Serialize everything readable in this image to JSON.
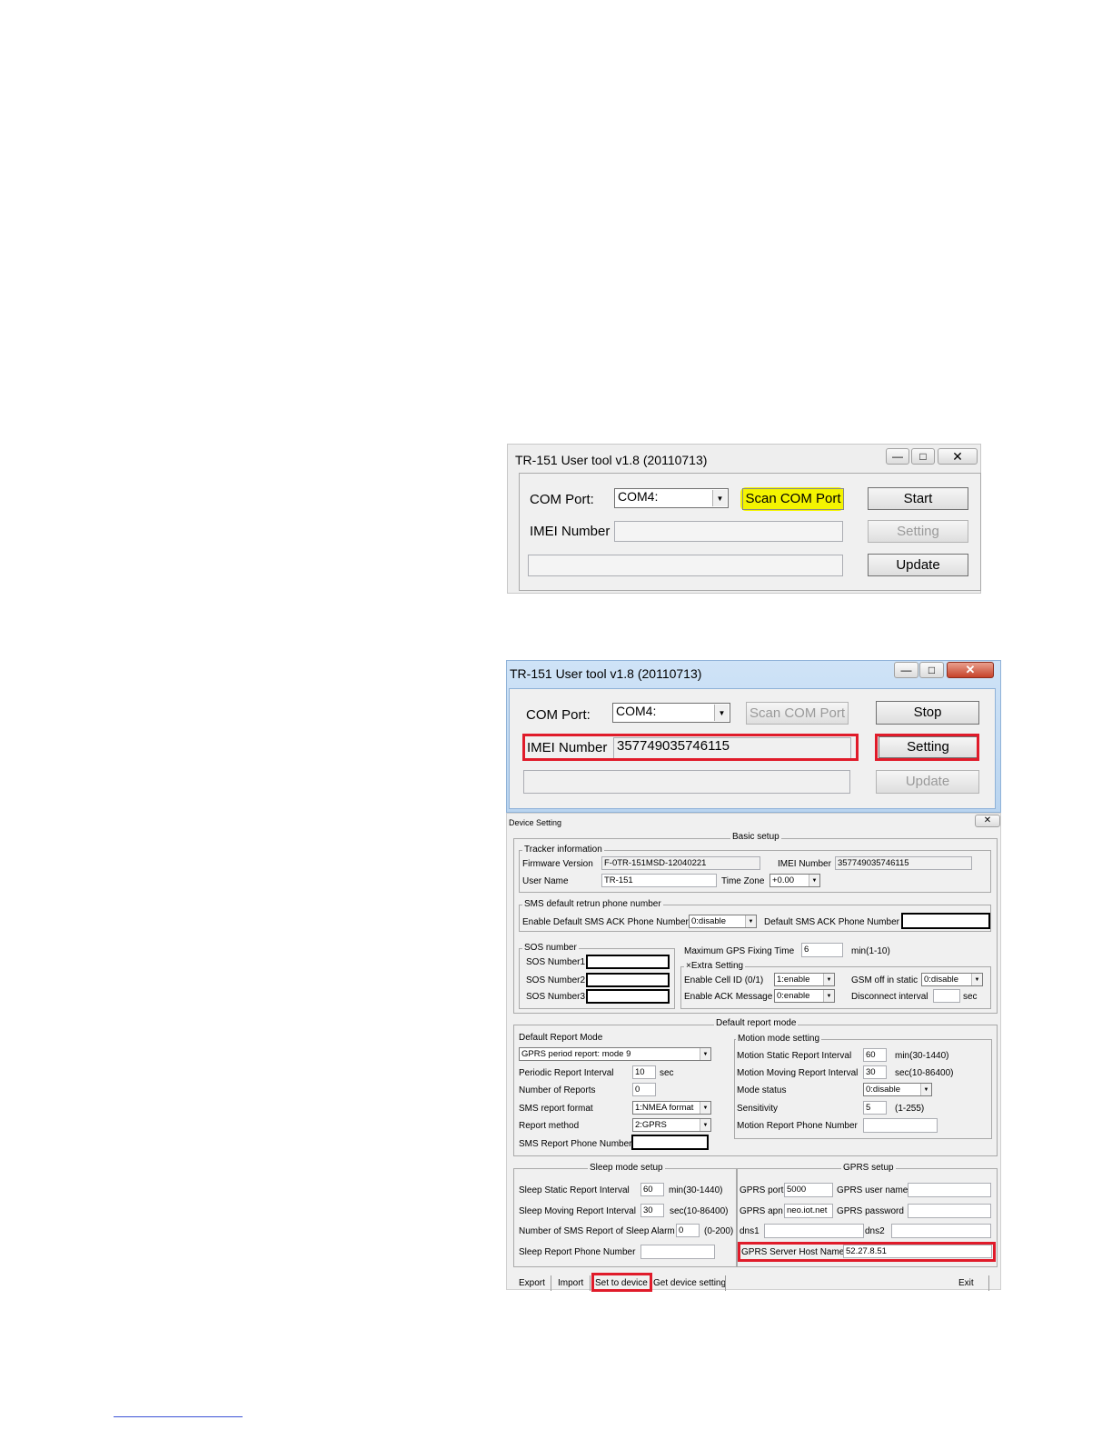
{
  "window1": {
    "title": "TR-151 User tool v1.8 (20110713)",
    "com_port_label": "COM Port:",
    "com_port_value": "COM4:",
    "scan_button": "Scan COM Port",
    "start_button": "Start",
    "imei_label": "IMEI Number",
    "imei_value": "",
    "setting_button": "Setting",
    "update_button": "Update",
    "highlight_color": "#f4f400"
  },
  "window2": {
    "title": "TR-151 User tool v1.8 (20110713)",
    "com_port_label": "COM Port:",
    "com_port_value": "COM4:",
    "scan_button": "Scan COM Port",
    "stop_button": "Stop",
    "imei_label": "IMEI Number",
    "imei_value": "357749035746115",
    "setting_button": "Setting",
    "update_button": "Update",
    "annotation_color": "#e01b2a"
  },
  "device_setting": {
    "title": "Device Setting",
    "basic_setup": {
      "title": "Basic setup",
      "tracker_info": {
        "title": "Tracker information",
        "firmware_label": "Firmware Version",
        "firmware_value": "F-0TR-151MSD-12040221",
        "imei_label": "IMEI Number",
        "imei_value": "357749035746115",
        "username_label": "User Name",
        "username_value": "TR-151",
        "timezone_label": "Time Zone",
        "timezone_value": "+0.00"
      },
      "sms_default": {
        "title": "SMS default retrun phone number",
        "enable_label": "Enable Default SMS ACK Phone Number",
        "enable_value": "0:disable",
        "phone_label": "Default SMS ACK Phone Number"
      },
      "sos": {
        "title": "SOS number",
        "n1": "SOS Number1",
        "n2": "SOS Number2",
        "n3": "SOS Number3"
      },
      "max_gps_label": "Maximum GPS Fixing Time",
      "max_gps_value": "6",
      "max_gps_unit": "min(1-10)",
      "extra": {
        "title": "Extra Setting",
        "cell_id_label": "Enable Cell ID (0/1)",
        "cell_id_value": "1:enable",
        "ack_label": "Enable ACK Message",
        "ack_value": "0:enable",
        "gsm_label": "GSM off in static",
        "gsm_value": "0:disable",
        "disconnect_label": "Disconnect interval",
        "disconnect_unit": "sec"
      }
    },
    "default_report": {
      "title": "Default report mode",
      "mode_label": "Default Report Mode",
      "mode_value": "GPRS period report: mode 9",
      "periodic_label": "Periodic Report Interval",
      "periodic_value": "10",
      "periodic_unit": "sec",
      "num_reports_label": "Number of Reports",
      "num_reports_value": "0",
      "sms_format_label": "SMS report format",
      "sms_format_value": "1:NMEA format",
      "method_label": "Report method",
      "method_value": "2:GPRS",
      "sms_phone_label": "SMS Report Phone Number",
      "motion": {
        "title": "Motion mode setting",
        "static_label": "Motion Static Report Interval",
        "static_value": "60",
        "static_unit": "min(30-1440)",
        "moving_label": "Motion Moving Report Interval",
        "moving_value": "30",
        "moving_unit": "sec(10-86400)",
        "status_label": "Mode status",
        "status_value": "0:disable",
        "sens_label": "Sensitivity",
        "sens_value": "5",
        "sens_unit": "(1-255)",
        "phone_label": "Motion Report Phone Number"
      }
    },
    "sleep": {
      "title": "Sleep mode setup",
      "static_label": "Sleep Static Report Interval",
      "static_value": "60",
      "static_unit": "min(30-1440)",
      "moving_label": "Sleep Moving Report Interval",
      "moving_value": "30",
      "moving_unit": "sec(10-86400)",
      "alarm_label": "Number of SMS Report of Sleep Alarm",
      "alarm_value": "0",
      "alarm_unit": "(0-200)",
      "phone_label": "Sleep Report Phone Number"
    },
    "gprs": {
      "title": "GPRS setup",
      "port_label": "GPRS port",
      "port_value": "5000",
      "user_label": "GPRS user name",
      "apn_label": "GPRS apn",
      "apn_value": "neo.iot.net",
      "password_label": "GPRS password",
      "dns1_label": "dns1",
      "dns2_label": "dns2",
      "host_label": "GPRS Server Host Name",
      "host_value": "52.27.8.51"
    },
    "toolbar": {
      "export": "Export",
      "import": "Import",
      "set_to_device": "Set to device",
      "get_setting": "Get device setting",
      "exit": "Exit"
    }
  }
}
